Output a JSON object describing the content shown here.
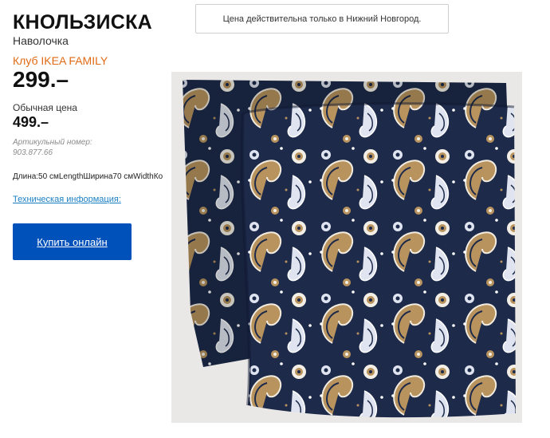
{
  "product": {
    "name": "КНОЛЬЗИСКА",
    "type": "Наволочка",
    "family_label": "Клуб IKEA FAMILY",
    "family_price": "299.–",
    "regular_label": "Обычная цена",
    "regular_price": "499.–",
    "article_label": "Артикульный номер: 903.877.66",
    "dimensions": "Длина:50 смLengthШирина70 смWidthКо",
    "tech_info_link": "Техническая информация:",
    "buy_button": "Купить онлайн"
  },
  "notice": {
    "text": "Цена действительна только в Нижний Новгород."
  },
  "image": {
    "subject": "paisley-pillowcase-photo",
    "colors": {
      "background": "#e9e8e6",
      "fabric_navy": "#1d2a4a",
      "paisley_tan": "#b8935e",
      "paisley_light": "#dfe4f0"
    }
  },
  "colors": {
    "accent_orange": "#e06a12",
    "button_blue": "#0051ba",
    "link_blue": "#1a7fc4"
  }
}
